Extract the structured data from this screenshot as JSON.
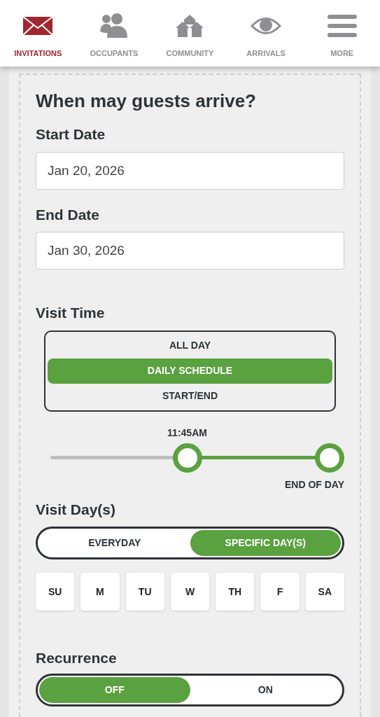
{
  "nav": [
    {
      "label": "INVITATIONS",
      "selected": true
    },
    {
      "label": "OCCUPANTS",
      "selected": false
    },
    {
      "label": "COMMUNITY",
      "selected": false
    },
    {
      "label": "ARRIVALS",
      "selected": false
    },
    {
      "label": "MORE",
      "selected": false
    }
  ],
  "heading": "When may guests arrive?",
  "start_date": {
    "label": "Start Date",
    "value": "Jan 20, 2026"
  },
  "end_date": {
    "label": "End Date",
    "value": "Jan 30, 2026"
  },
  "visit_time": {
    "label": "Visit Time",
    "options": [
      {
        "label": "ALL DAY",
        "selected": false
      },
      {
        "label": "DAILY SCHEDULE",
        "selected": true
      },
      {
        "label": "START/END",
        "selected": false
      }
    ],
    "slider": {
      "thumbs": [
        {
          "label": "11:45AM",
          "level": 0.49
        },
        {
          "label": "END OF DAY",
          "level": 1
        }
      ]
    }
  },
  "visit_days": {
    "label": "Visit Day(s)",
    "options": [
      {
        "label": "EVERYDAY",
        "selected": false
      },
      {
        "label": "SPECIFIC DAY(S)",
        "selected": true
      }
    ],
    "days": [
      {
        "label": "SU",
        "selected": false
      },
      {
        "label": "M",
        "selected": false
      },
      {
        "label": "TU",
        "selected": false
      },
      {
        "label": "W",
        "selected": false
      },
      {
        "label": "TH",
        "selected": false
      },
      {
        "label": "F",
        "selected": false
      },
      {
        "label": "SA",
        "selected": false
      }
    ]
  },
  "recurrence": {
    "label": "Recurrence",
    "options": [
      {
        "label": "OFF",
        "selected": true
      },
      {
        "label": "ON",
        "selected": false
      }
    ]
  }
}
